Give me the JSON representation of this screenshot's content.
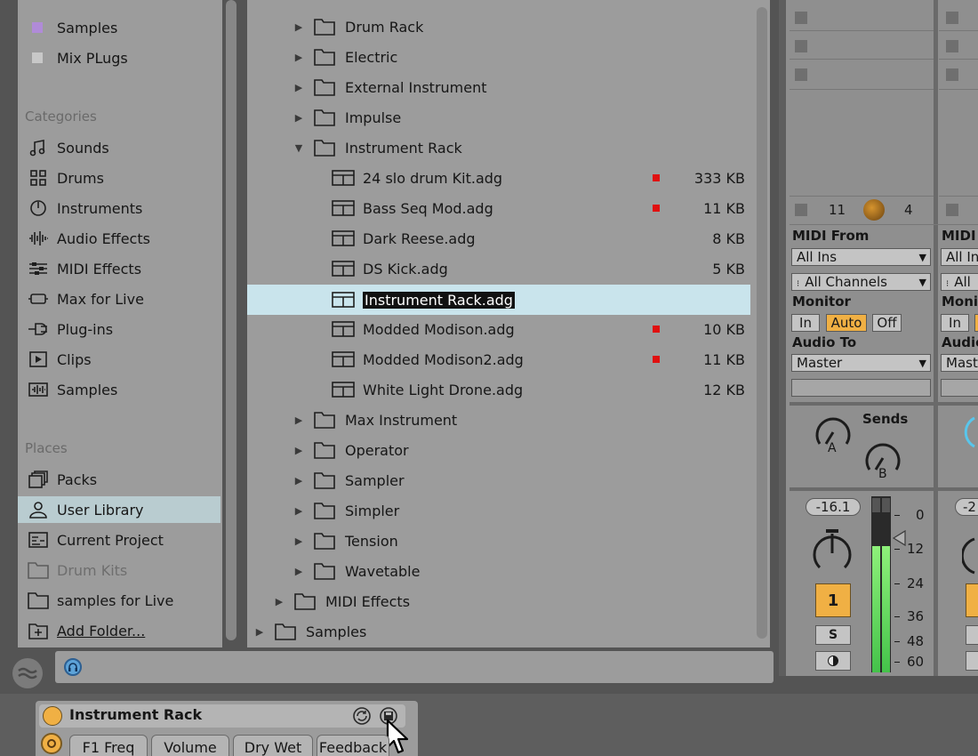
{
  "sidebar": {
    "top_items": [
      {
        "label": "Samples",
        "color": "#b08bd8"
      },
      {
        "label": "Mix PLugs",
        "color": "#c8c8c8"
      }
    ],
    "categories_header": "Categories",
    "categories": [
      {
        "label": "Sounds",
        "icon": "music-note-icon"
      },
      {
        "label": "Drums",
        "icon": "drums-grid-icon"
      },
      {
        "label": "Instruments",
        "icon": "instrument-clock-icon"
      },
      {
        "label": "Audio Effects",
        "icon": "waveform-icon"
      },
      {
        "label": "MIDI Effects",
        "icon": "midi-effects-icon"
      },
      {
        "label": "Max for Live",
        "icon": "max-for-live-icon"
      },
      {
        "label": "Plug-ins",
        "icon": "plugin-icon"
      },
      {
        "label": "Clips",
        "icon": "clip-play-icon"
      },
      {
        "label": "Samples",
        "icon": "sample-wave-icon"
      }
    ],
    "places_header": "Places",
    "places": [
      {
        "label": "Packs",
        "icon": "packs-icon"
      },
      {
        "label": "User Library",
        "icon": "user-icon",
        "selected": true
      },
      {
        "label": "Current Project",
        "icon": "project-icon"
      },
      {
        "label": "Drum Kits",
        "icon": "folder-icon",
        "dim": true
      },
      {
        "label": "samples for Live",
        "icon": "folder-icon"
      },
      {
        "label": "Add Folder...",
        "icon": "add-folder-icon",
        "underline": true
      }
    ]
  },
  "browser": {
    "rows": [
      {
        "type": "folder",
        "label": "Drum Rack",
        "indent": 1
      },
      {
        "type": "folder",
        "label": "Electric",
        "indent": 1
      },
      {
        "type": "folder",
        "label": "External Instrument",
        "indent": 1
      },
      {
        "type": "folder",
        "label": "Impulse",
        "indent": 1
      },
      {
        "type": "folder",
        "label": "Instrument Rack",
        "indent": 1,
        "expanded": true
      },
      {
        "type": "file",
        "label": "24  slo drum Kit.adg",
        "size": "333 KB",
        "hot": true
      },
      {
        "type": "file",
        "label": "Bass Seq Mod.adg",
        "size": "11 KB",
        "hot": true
      },
      {
        "type": "file",
        "label": "Dark Reese.adg",
        "size": "8 KB",
        "hot": false
      },
      {
        "type": "file",
        "label": "DS Kick.adg",
        "size": "5 KB",
        "hot": false
      },
      {
        "type": "file",
        "label": "Instrument Rack.adg",
        "size": "",
        "hot": false,
        "selected": true
      },
      {
        "type": "file",
        "label": "Modded Modison.adg",
        "size": "10 KB",
        "hot": true
      },
      {
        "type": "file",
        "label": "Modded Modison2.adg",
        "size": "11 KB",
        "hot": true
      },
      {
        "type": "file",
        "label": "White Light Drone.adg",
        "size": "12 KB",
        "hot": false
      },
      {
        "type": "folder",
        "label": "Max Instrument",
        "indent": 1
      },
      {
        "type": "folder",
        "label": "Operator",
        "indent": 1
      },
      {
        "type": "folder",
        "label": "Sampler",
        "indent": 1
      },
      {
        "type": "folder",
        "label": "Simpler",
        "indent": 1
      },
      {
        "type": "folder",
        "label": "Tension",
        "indent": 1
      },
      {
        "type": "folder",
        "label": "Wavetable",
        "indent": 1
      },
      {
        "type": "folder",
        "label": "MIDI Effects",
        "indent": 0
      },
      {
        "type": "folder",
        "label": "Samples",
        "indent": -1
      }
    ]
  },
  "mixer": {
    "track_counter": "11",
    "track_counter2": "4",
    "midi_from_label": "MIDI From",
    "midi_from_label2": "MIDI",
    "input_type": "All Ins",
    "input_type2": "All In",
    "input_channel": "All Channels",
    "input_channel2": "All",
    "monitor_label": "Monitor",
    "monitor_label2": "Monit",
    "monitor_in": "In",
    "monitor_in2": "In",
    "monitor_auto": "Auto",
    "monitor_off": "Off",
    "audio_to_label": "Audio To",
    "audio_to_label2": "Audio",
    "audio_to": "Master",
    "audio_to2": "Mast",
    "sends_label": "Sends",
    "send_a": "A",
    "send_b": "B",
    "volume": "-16.1",
    "volume2": "-2",
    "track_number": "1",
    "solo": "S",
    "db_scale": [
      "0",
      "12",
      "24",
      "36",
      "48",
      "60"
    ],
    "meter_level": 0.8
  },
  "device": {
    "title": "Instrument Rack",
    "macros": [
      "F1 Freq",
      "Volume",
      "Dry Wet",
      "Feedback"
    ]
  },
  "colors": {
    "selection_highlight": "#c9e4ec",
    "hot_marker": "#e01010",
    "accent": "#f0b044"
  }
}
